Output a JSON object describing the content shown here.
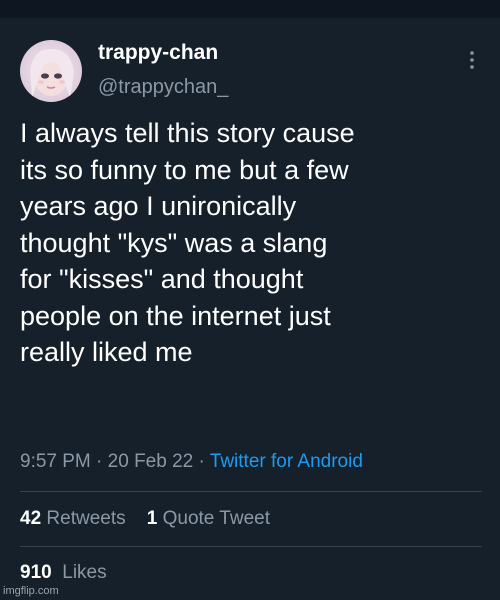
{
  "tweet": {
    "display_name": "trappy-chan",
    "handle": "@trappychan_",
    "text": "I always tell this story cause\nits so funny to me but a few\nyears ago I unironically\nthought \"kys\" was a slang\nfor \"kisses\" and thought\npeople on the internet just\nreally liked me",
    "time": "9:57 PM",
    "date": "20 Feb 22",
    "separator": "·",
    "source": "Twitter for Android"
  },
  "stats": {
    "retweets_count": "42",
    "retweets_label": "Retweets",
    "quote_count": "1",
    "quote_label": "Quote Tweet",
    "likes_count": "910",
    "likes_label": "Likes"
  },
  "watermark": "imgflip.com",
  "icons": {
    "more": "more-vertical-icon",
    "avatar": "profile-avatar"
  },
  "colors": {
    "background": "#15202b",
    "text": "#ffffff",
    "secondary_text": "#8b98a5",
    "link": "#1d9bf0",
    "divider": "#38444d"
  }
}
